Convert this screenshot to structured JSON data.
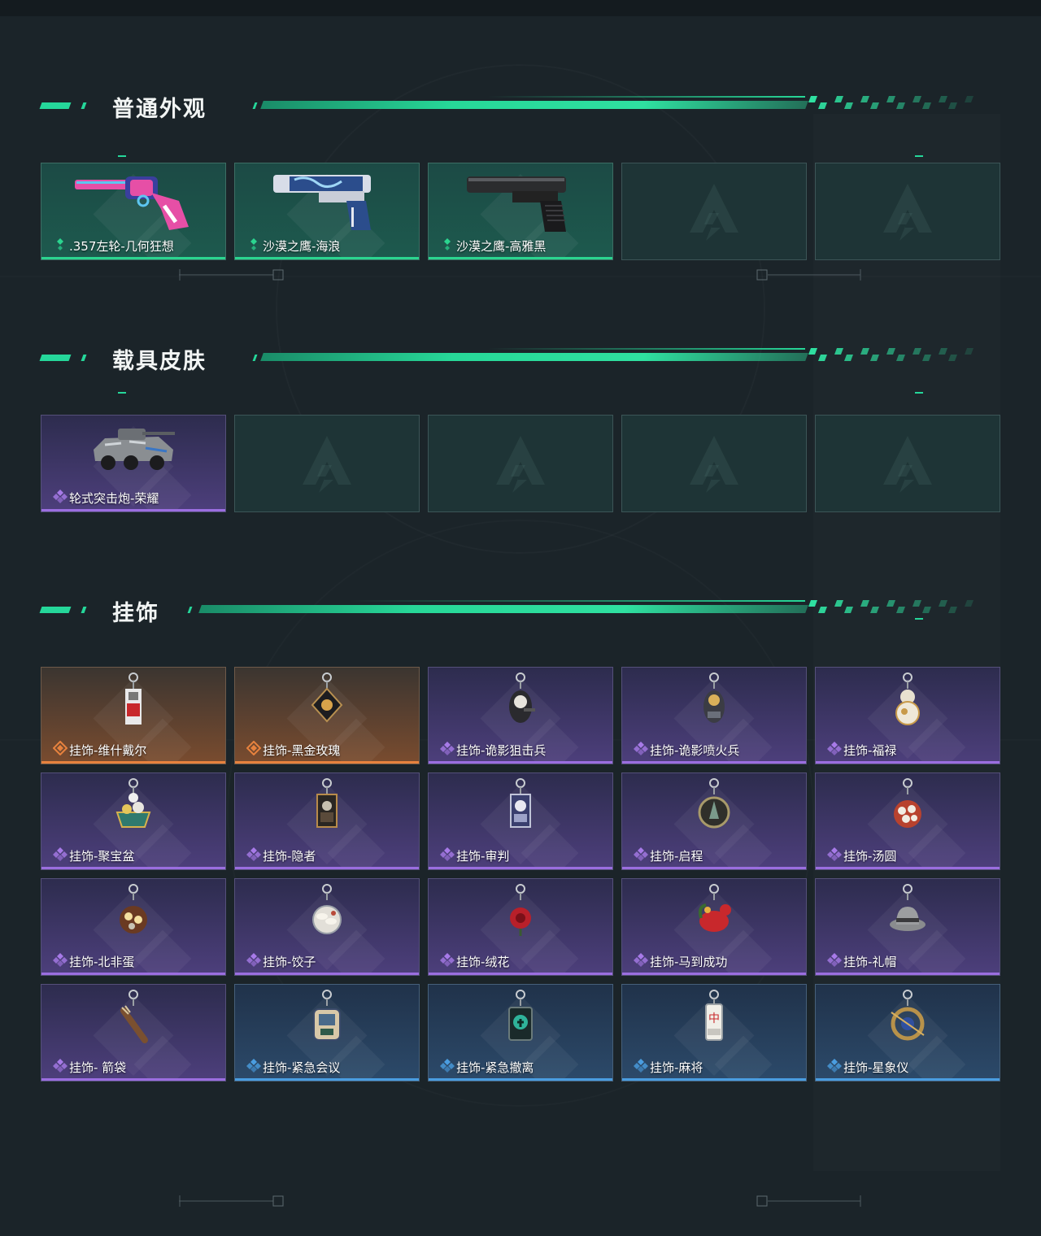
{
  "sections": [
    {
      "title": "普通外观",
      "items": [
        {
          "label": ".357左轮-几何狂想",
          "rarity": "green",
          "icon": "revolver-icon"
        },
        {
          "label": "沙漠之鹰-海浪",
          "rarity": "green",
          "icon": "desert-eagle-wave-icon"
        },
        {
          "label": "沙漠之鹰-高雅黑",
          "rarity": "green",
          "icon": "desert-eagle-black-icon"
        },
        {
          "label": "",
          "rarity": "empty",
          "icon": "empty-slot-logo-icon"
        },
        {
          "label": "",
          "rarity": "empty",
          "icon": "empty-slot-logo-icon"
        }
      ]
    },
    {
      "title": "载具皮肤",
      "items": [
        {
          "label": "轮式突击炮-荣耀",
          "rarity": "purple",
          "icon": "armored-vehicle-icon"
        },
        {
          "label": "",
          "rarity": "empty",
          "icon": "empty-slot-logo-icon"
        },
        {
          "label": "",
          "rarity": "empty",
          "icon": "empty-slot-logo-icon"
        },
        {
          "label": "",
          "rarity": "empty",
          "icon": "empty-slot-logo-icon"
        },
        {
          "label": "",
          "rarity": "empty",
          "icon": "empty-slot-logo-icon"
        }
      ]
    },
    {
      "title": "挂饰",
      "items": [
        {
          "label": "挂饰-维什戴尔",
          "rarity": "orange",
          "icon": "card-charm-icon"
        },
        {
          "label": "挂饰-黑金玫瑰",
          "rarity": "orange",
          "icon": "black-gold-rose-charm-icon"
        },
        {
          "label": "挂饰-诡影狙击兵",
          "rarity": "purple",
          "icon": "sniper-charm-icon"
        },
        {
          "label": "挂饰-诡影喷火兵",
          "rarity": "purple",
          "icon": "flamethrower-charm-icon"
        },
        {
          "label": "挂饰-福禄",
          "rarity": "purple",
          "icon": "gourd-charm-icon"
        },
        {
          "label": "挂饰-聚宝盆",
          "rarity": "purple",
          "icon": "treasure-bowl-charm-icon"
        },
        {
          "label": "挂饰-隐者",
          "rarity": "purple",
          "icon": "tarot-hermit-charm-icon"
        },
        {
          "label": "挂饰-审判",
          "rarity": "purple",
          "icon": "tarot-judgement-charm-icon"
        },
        {
          "label": "挂饰-启程",
          "rarity": "purple",
          "icon": "compass-charm-icon"
        },
        {
          "label": "挂饰-汤圆",
          "rarity": "purple",
          "icon": "rice-ball-charm-icon"
        },
        {
          "label": "挂饰-北非蛋",
          "rarity": "purple",
          "icon": "shakshuka-charm-icon"
        },
        {
          "label": "挂饰-饺子",
          "rarity": "purple",
          "icon": "dumpling-charm-icon"
        },
        {
          "label": "挂饰-绒花",
          "rarity": "purple",
          "icon": "velvet-flower-charm-icon"
        },
        {
          "label": "挂饰-马到成功",
          "rarity": "purple",
          "icon": "horse-charm-icon"
        },
        {
          "label": "挂饰-礼帽",
          "rarity": "purple",
          "icon": "fedora-charm-icon"
        },
        {
          "label": "挂饰- 箭袋",
          "rarity": "purple",
          "icon": "quiver-charm-icon"
        },
        {
          "label": "挂饰-紧急会议",
          "rarity": "blue",
          "icon": "meeting-charm-icon"
        },
        {
          "label": "挂饰-紧急撤离",
          "rarity": "blue",
          "icon": "evacuation-charm-icon"
        },
        {
          "label": "挂饰-麻将",
          "rarity": "blue",
          "icon": "mahjong-charm-icon"
        },
        {
          "label": "挂饰-星象仪",
          "rarity": "blue",
          "icon": "astrolabe-charm-icon"
        }
      ]
    }
  ],
  "colors": {
    "accent": "#25d79a",
    "green": "#2bd58f",
    "purple": "#9b6ee0",
    "orange": "#e7823e",
    "blue": "#4a9de0"
  }
}
